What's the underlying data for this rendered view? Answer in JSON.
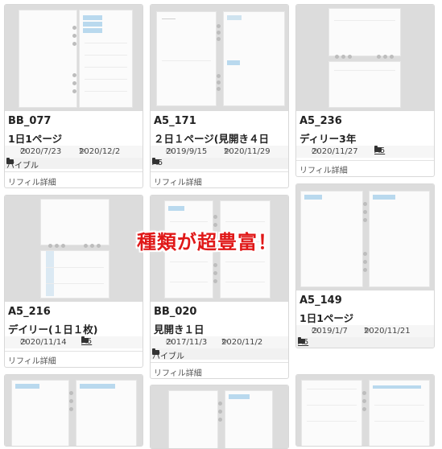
{
  "overlay_text": "種類が超豊富！",
  "icons": {
    "date": "clock-icon",
    "updated": "refresh-icon",
    "category": "folder-icon"
  },
  "cards": [
    {
      "code": "BB_077",
      "name": "1日1ページ",
      "date": "2020/7/23",
      "updated": "2020/12/2",
      "category": "バイブル",
      "link": "リフィル詳細"
    },
    {
      "code": "A5_171",
      "name": "２日１ページ(見開き４日",
      "date": "2019/9/15",
      "updated": "2020/11/29",
      "category": "A5",
      "link": "リフィル詳細"
    },
    {
      "code": "A5_236",
      "name": "ディリー3年",
      "date": "2020/11/27",
      "updated": "",
      "category": "A5",
      "link": "リフィル詳細"
    },
    {
      "code": "A5_216",
      "name": "デイリー(１日１枚)",
      "date": "2020/11/14",
      "updated": "",
      "category": "A5",
      "link": "リフィル詳細"
    },
    {
      "code": "BB_020",
      "name": "見開き１日",
      "date": "2017/11/3",
      "updated": "2020/11/2",
      "category": "バイブル",
      "link": "リフィル詳細"
    },
    {
      "code": "A5_149",
      "name": "1日1ページ",
      "date": "2019/1/7",
      "updated": "2020/11/21",
      "category": "A5",
      "link": ""
    }
  ]
}
